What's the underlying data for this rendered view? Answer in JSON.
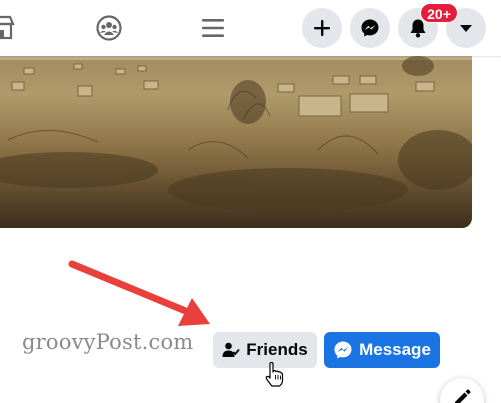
{
  "topbar": {
    "icons": [
      "marketplace-icon",
      "groups-icon",
      "menu-icon"
    ],
    "buttons": [
      "create-icon",
      "messenger-icon",
      "notifications-bell-icon",
      "account-caret-icon"
    ],
    "notification_badge": "20+"
  },
  "profile_actions": {
    "friends_label": "Friends",
    "message_label": "Message"
  },
  "watermark": "groovyPost.com",
  "colors": {
    "primary_blue": "#1b74e4",
    "badge_red": "#e41e3f",
    "button_grey": "#e4e6eb",
    "arrow_red": "#e8403a"
  }
}
